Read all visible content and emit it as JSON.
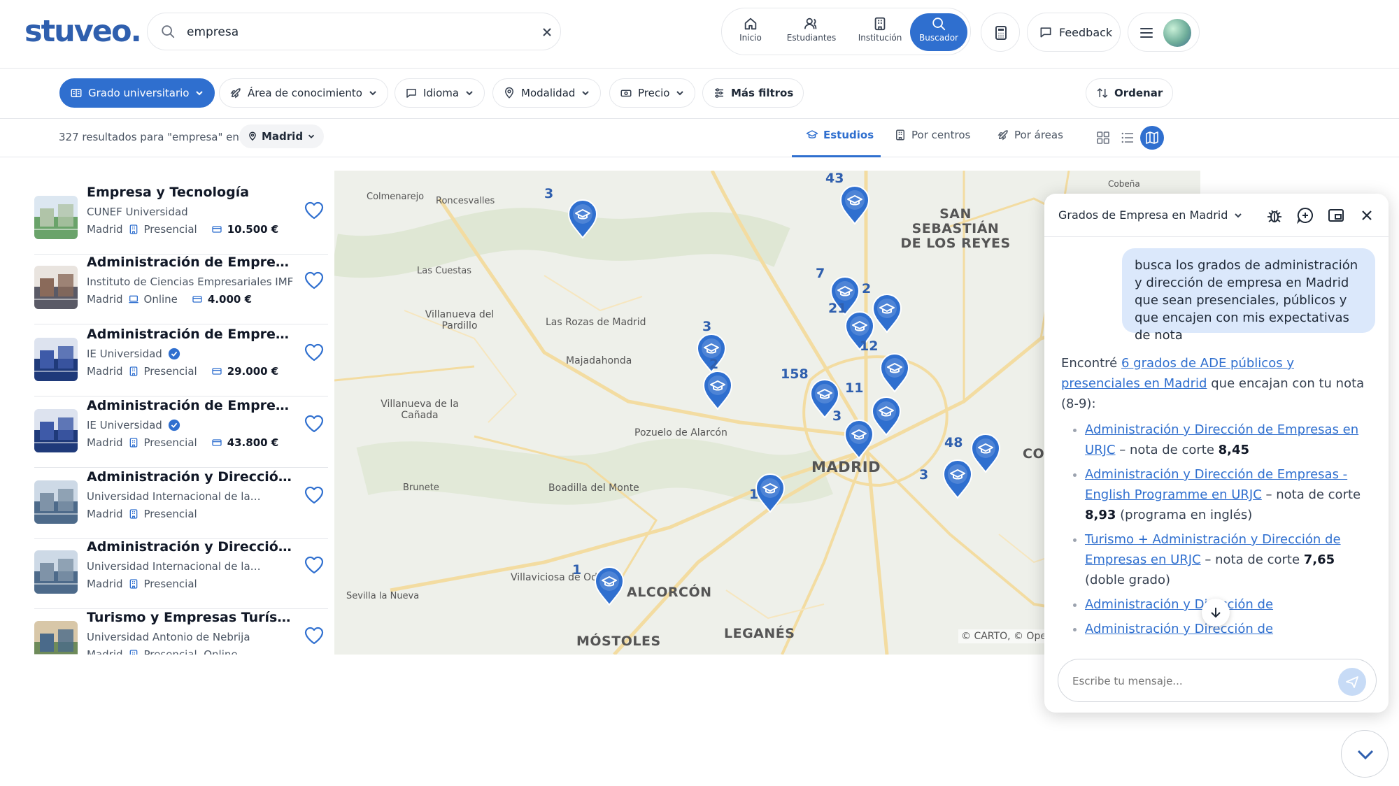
{
  "brand": {
    "logo": "stuveo."
  },
  "search": {
    "value": "empresa"
  },
  "nav": {
    "items": [
      {
        "label": "Inicio",
        "icon": "home-icon"
      },
      {
        "label": "Estudiantes",
        "icon": "users-icon"
      },
      {
        "label": "Institución",
        "icon": "building-icon"
      },
      {
        "label": "Buscador",
        "icon": "search-icon"
      }
    ],
    "feedback_label": "Feedback"
  },
  "filters": [
    {
      "label": "Grado universitario",
      "icon": "degree-icon"
    },
    {
      "label": "Área de conocimiento",
      "icon": "rocket-icon"
    },
    {
      "label": "Idioma",
      "icon": "chat-icon"
    },
    {
      "label": "Modalidad",
      "icon": "location-icon"
    },
    {
      "label": "Precio",
      "icon": "price-icon"
    },
    {
      "label": "Más filtros",
      "icon": "sliders-icon"
    }
  ],
  "sort_label": "Ordenar",
  "results": {
    "count_text": "327 resultados para \"empresa\" en",
    "location": "Madrid"
  },
  "tabs": [
    {
      "label": "Estudios",
      "icon": "graduation-cap-icon"
    },
    {
      "label": "Por centros",
      "icon": "building-icon"
    },
    {
      "label": "Por áreas",
      "icon": "rocket-icon"
    }
  ],
  "list": [
    {
      "title": "Empresa y Tecnología",
      "university": "CUNEF Universidad",
      "verified": false,
      "city": "Madrid",
      "modality": "Presencial",
      "price": "10.500 €"
    },
    {
      "title": "Administración de Empresas",
      "university": "Instituto de Ciencias Empresariales IMF",
      "verified": false,
      "city": "Madrid",
      "modality": "Online",
      "price": "4.000 €"
    },
    {
      "title": "Administración de Empresas",
      "university": "IE Universidad",
      "verified": true,
      "city": "Madrid",
      "modality": "Presencial",
      "price": "29.000 €"
    },
    {
      "title": "Administración de Empresas",
      "university": "IE Universidad",
      "verified": true,
      "city": "Madrid",
      "modality": "Presencial",
      "price": "43.800 €"
    },
    {
      "title": "Administración y Dirección de…",
      "university": "Universidad Internacional de la…",
      "verified": false,
      "city": "Madrid",
      "modality": "Presencial",
      "price": ""
    },
    {
      "title": "Administración y Dirección de…",
      "university": "Universidad Internacional de la…",
      "verified": false,
      "city": "Madrid",
      "modality": "Presencial",
      "price": ""
    },
    {
      "title": "Turismo y Empresas Turísticas",
      "university": "Universidad Antonio de Nebrija",
      "verified": false,
      "city": "Madrid",
      "modality": "Presencial, Online",
      "price": ""
    }
  ],
  "map": {
    "places": [
      "Colmenarejo",
      "Roncesvalles",
      "Las Cuestas",
      "Villanueva del Pardillo",
      "Las Rozas de Madrid",
      "Majadahonda",
      "Villanueva de la Cañada",
      "Pozuelo de Alarcón",
      "Brunete",
      "Boadilla del Monte",
      "Villaviciosa de Odón",
      "Sevilla la Nueva",
      "Cobeña"
    ],
    "cities": [
      "SAN SEBASTIÁN DE LOS REYES",
      "MADRID",
      "ALCORCÓN",
      "MÓSTOLES",
      "LEGANÉS",
      "COS"
    ],
    "cluster_counts": [
      "3",
      "43",
      "7",
      "2",
      "21",
      "12",
      "3",
      "2",
      "158",
      "11",
      "3",
      "48",
      "3",
      "1",
      "1"
    ],
    "attribution": "© CARTO, © Ope"
  },
  "chat": {
    "title": "Grados de Empresa en Madrid",
    "user_message": "busca los grados de administración y dirección de empresa en Madrid que sean presenciales, públicos y que encajen con mis expectativas de nota",
    "bot_intro_pre": "Encontré",
    "bot_intro_link": "6 grados de ADE públicos y presenciales en Madrid",
    "bot_intro_post": "que encajan con tu nota (8-9):",
    "results": [
      {
        "link": "Administración y Dirección de Empresas en URJC",
        "text": " – nota de corte ",
        "grade": "8,45",
        "extra": ""
      },
      {
        "link": "Administración y Dirección de Empresas - English Programme en URJC",
        "text": " – nota de corte ",
        "grade": "8,93",
        "extra": " (programa en inglés)"
      },
      {
        "link": "Turismo + Administración y Dirección de Empresas en URJC",
        "text": " – nota de corte ",
        "grade": "7,65",
        "extra": " (doble grado)"
      },
      {
        "link": "Administración y Dirección de",
        "text": "",
        "grade": "",
        "extra": ""
      },
      {
        "link": "Administración y Dirección de",
        "text": "",
        "grade": "",
        "extra": ""
      }
    ],
    "input_placeholder": "Escribe tu mensaje..."
  },
  "colors": {
    "accent": "#2f6fcf",
    "pin": "#2f6fcf",
    "bubble": "#dbe8fb"
  }
}
